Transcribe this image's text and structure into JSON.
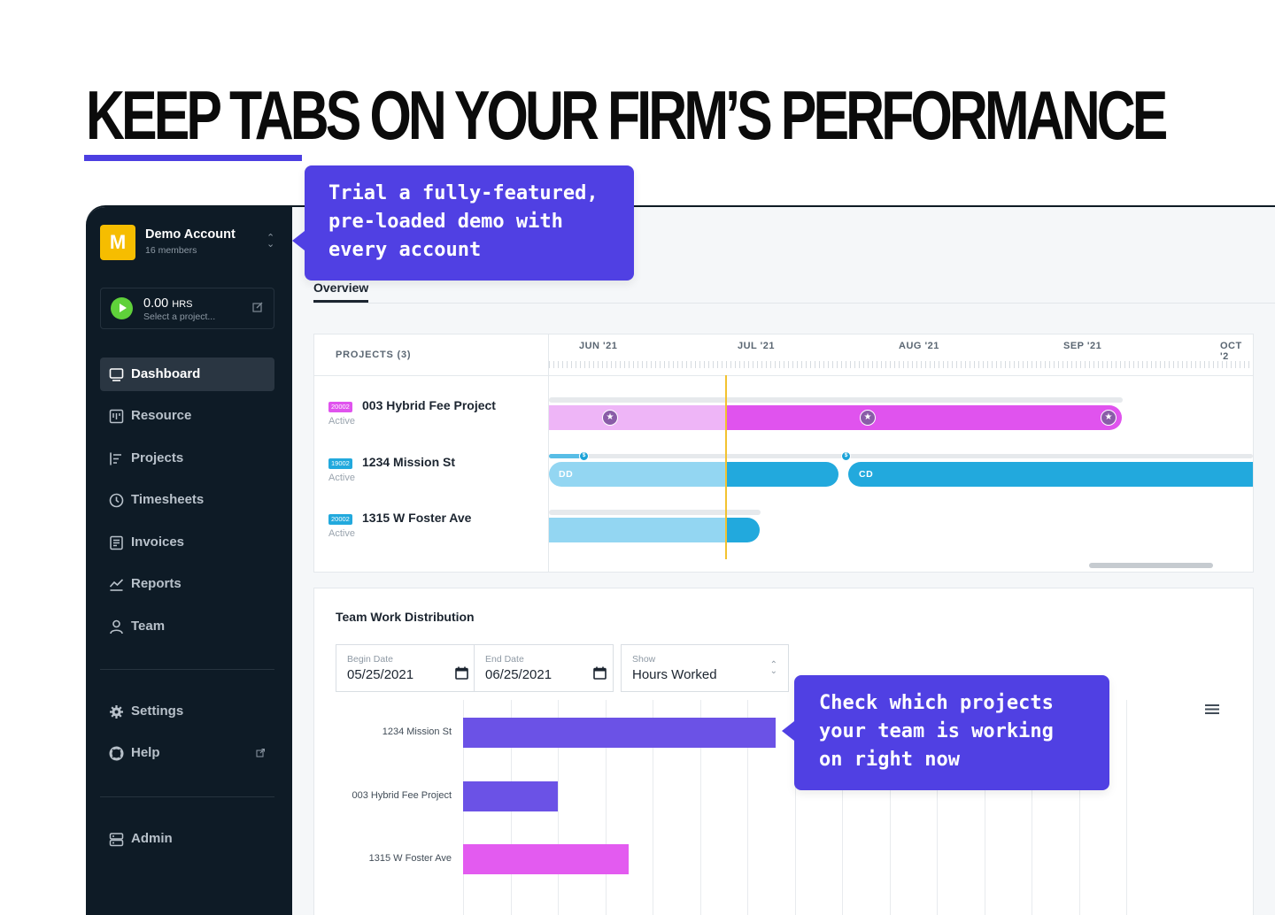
{
  "headline": "KEEP TABS ON YOUR FIRM’S PERFORMANCE",
  "brand": {
    "accent": "#4c3fe1",
    "sidebar_bg": "#0e1b26",
    "callout_bg": "#5040e3"
  },
  "callouts": {
    "demo": [
      "Trial a fully-featured,",
      "pre-loaded demo with",
      "every account"
    ],
    "team": [
      "Check which projects",
      "your team is working",
      "on right now"
    ]
  },
  "account": {
    "logo_letter": "M",
    "name": "Demo Account",
    "members": "16 members",
    "switch_icon": "chevron-updown-icon"
  },
  "timer": {
    "value": "0.00",
    "unit": "HRS",
    "prompt": "Select a project...",
    "play_icon": "play-icon",
    "edit_icon": "edit-icon"
  },
  "nav": {
    "main": [
      {
        "label": "Dashboard",
        "icon": "dashboard-icon"
      },
      {
        "label": "Resource",
        "icon": "resource-icon"
      },
      {
        "label": "Projects",
        "icon": "projects-icon"
      },
      {
        "label": "Timesheets",
        "icon": "clock-icon"
      },
      {
        "label": "Invoices",
        "icon": "invoice-icon"
      },
      {
        "label": "Reports",
        "icon": "chart-line-icon"
      },
      {
        "label": "Team",
        "icon": "person-icon"
      }
    ],
    "secondary": [
      {
        "label": "Settings",
        "icon": "gear-icon"
      },
      {
        "label": "Help",
        "icon": "lifebuoy-icon"
      }
    ],
    "admin": {
      "label": "Admin",
      "icon": "server-icon"
    }
  },
  "tabs": {
    "overview": "Overview"
  },
  "timeline": {
    "projects_label": "PROJECTS (3)",
    "months": [
      "JUN '21",
      "JUL '21",
      "AUG '21",
      "SEP '21",
      "OCT '2"
    ],
    "projects": [
      {
        "code": "20002",
        "name": "003 Hybrid Fee Project",
        "status": "Active",
        "color": "#e053ee"
      },
      {
        "code": "19002",
        "name": "1234 Mission St",
        "status": "Active",
        "color": "#22a9dd",
        "phases": [
          "DD",
          "CD"
        ]
      },
      {
        "code": "20002",
        "name": "1315 W Foster Ave",
        "status": "Active",
        "color": "#22a9dd"
      }
    ]
  },
  "distribution": {
    "title": "Team Work Distribution",
    "begin_label": "Begin Date",
    "begin_value": "05/25/2021",
    "end_label": "End Date",
    "end_value": "06/25/2021",
    "show_label": "Show",
    "show_value": "Hours Worked"
  },
  "chart_data": {
    "type": "bar",
    "orientation": "horizontal",
    "categories": [
      "1234 Mission St",
      "003 Hybrid Fee Project",
      "1315 W Foster Ave"
    ],
    "values": [
      6.6,
      2.0,
      3.5
    ],
    "colors": [
      "#6b52e6",
      "#6b52e6",
      "#e35bf0"
    ],
    "xlim": [
      0,
      15
    ],
    "grid": true
  }
}
